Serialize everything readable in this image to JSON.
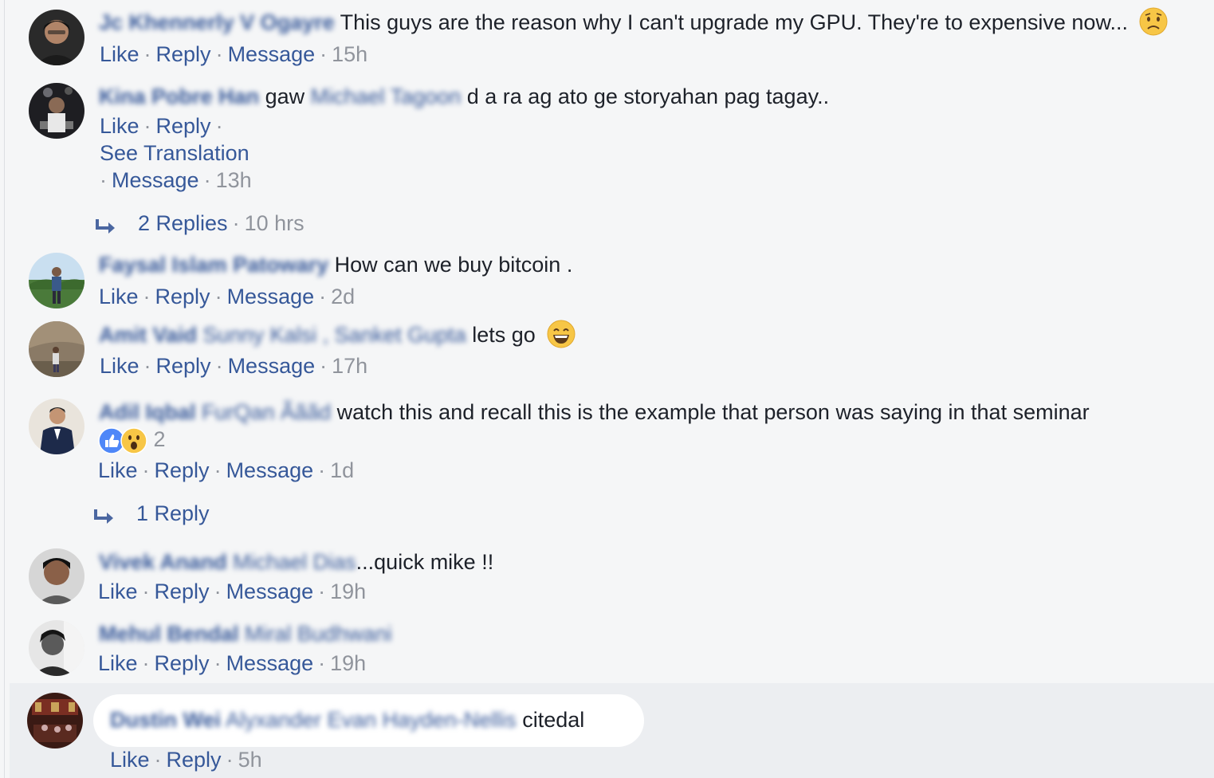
{
  "labels": {
    "like": "Like",
    "reply": "Reply",
    "message": "Message",
    "see_translation": "See Translation",
    "separator": "·"
  },
  "comments": [
    {
      "author": "Jc Khennerly V Ogayre",
      "text": "This guys are the reason why I can't upgrade my GPU. They're to expensive now...",
      "emoji": "worried-face-emoji",
      "time": "15h"
    },
    {
      "author": "Kina Pobre Han",
      "text_before": "gaw",
      "tagged": "Michael Tagoon",
      "text": "d a ra ag ato ge storyahan pag tagay..",
      "time": "13h",
      "replies": {
        "label": "2 Replies",
        "time": "10 hrs"
      }
    },
    {
      "author": "Faysal Islam Patowary",
      "text": "How can we buy bitcoin .",
      "time": "2d"
    },
    {
      "author": "Amit Vaid",
      "tagged": "Sunny Kalsi , Sanket Gupta",
      "text": "lets go",
      "emoji": "grinning-face-emoji",
      "time": "17h"
    },
    {
      "author": "Adil Iqbal",
      "tagged": "FurQan Ãããd",
      "text": "watch this and recall this is the example that person was saying in that seminar",
      "reactions": {
        "icons": [
          "like-reaction-icon",
          "wow-reaction-icon"
        ],
        "count": "2"
      },
      "time": "1d",
      "replies": {
        "label": "1 Reply"
      }
    },
    {
      "author": "Vivek Anand",
      "tagged": "Michael Dias",
      "text": "...quick mike !!",
      "time": "19h"
    },
    {
      "author": "Mehul Bendal",
      "tagged": "Miral Budhwani",
      "text": "",
      "time": "19h"
    },
    {
      "author": "Dustin Wei",
      "tagged": "Alyxander Evan Hayden-Nellis",
      "text": "citedal",
      "time": "5h"
    }
  ],
  "colors": {
    "link": "#365899",
    "meta": "#90949c",
    "text": "#1d2129",
    "background": "#f5f6f7"
  }
}
